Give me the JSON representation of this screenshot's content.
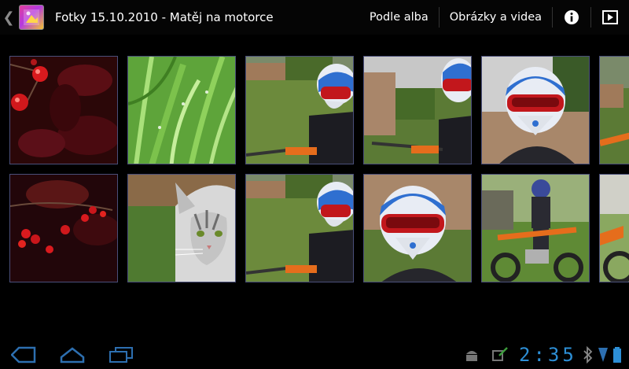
{
  "header": {
    "title": "Fotky 15.10.2010 - Matěj na motorce",
    "buttons": [
      {
        "label": "Podle alba"
      },
      {
        "label": "Obrázky a videa"
      }
    ],
    "icons": [
      "info-icon",
      "slideshow-icon"
    ]
  },
  "grid": {
    "thumbnails": [
      {
        "subject": "red berries",
        "row": 1
      },
      {
        "subject": "green grass",
        "row": 1
      },
      {
        "subject": "boy on motorbike",
        "row": 1
      },
      {
        "subject": "boy on motorbike",
        "row": 1
      },
      {
        "subject": "boy in helmet",
        "row": 1
      },
      {
        "subject": "boy on motorbike",
        "row": 1
      },
      {
        "subject": "red berries",
        "row": 2
      },
      {
        "subject": "cat",
        "row": 2
      },
      {
        "subject": "boy on motorbike",
        "row": 2
      },
      {
        "subject": "boy in helmet",
        "row": 2
      },
      {
        "subject": "boy on motorbike",
        "row": 2
      },
      {
        "subject": "orange motorbike",
        "row": 2
      }
    ]
  },
  "system_bar": {
    "clock": "2:35",
    "accent": "#2d8fd6"
  }
}
